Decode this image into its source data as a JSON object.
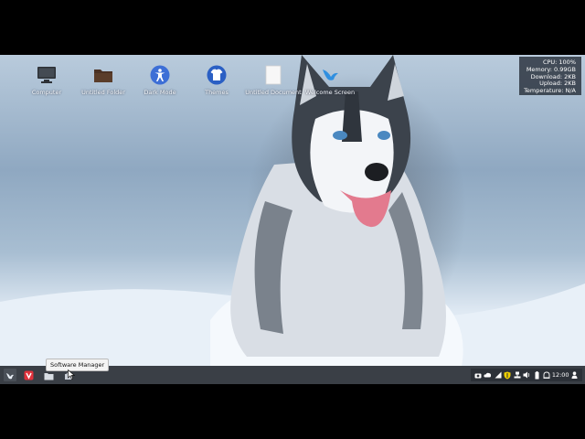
{
  "desktop": {
    "icons": [
      {
        "label": "Computer",
        "icon": "monitor-icon"
      },
      {
        "label": "Untitled Folder",
        "icon": "folder-icon"
      },
      {
        "label": "Dark Mode",
        "icon": "accessibility-icon"
      },
      {
        "label": "Themes",
        "icon": "tshirt-icon"
      },
      {
        "label": "Untitled Document",
        "icon": "document-icon"
      },
      {
        "label": "Welcome Screen",
        "icon": "bird-icon"
      }
    ]
  },
  "system_monitor": {
    "cpu": "CPU: 100%",
    "memory": "Memory: 0.99GB",
    "download": "Download: 2KB",
    "upload": "Upload: 2KB",
    "temperature": "Temperature: N/A"
  },
  "taskbar": {
    "launchers": [
      {
        "name": "menu-launcher",
        "icon": "bird-icon"
      },
      {
        "name": "vivaldi-browser",
        "icon": "vivaldi-icon"
      },
      {
        "name": "file-manager",
        "icon": "folder-icon"
      },
      {
        "name": "software-manager",
        "icon": "store-icon"
      }
    ],
    "tooltip": "Software Manager",
    "tray": {
      "icons": [
        "camera-icon",
        "cloud-icon",
        "network-icon",
        "shield-icon",
        "ethernet-icon",
        "volume-icon",
        "battery-icon",
        "bell-icon"
      ],
      "clock": "12:00"
    }
  },
  "colors": {
    "taskbar": "#3a3f46",
    "conky_bg": "#28303a",
    "accent_blue": "#3d6fd6",
    "folder_brown": "#5a3d2a"
  }
}
